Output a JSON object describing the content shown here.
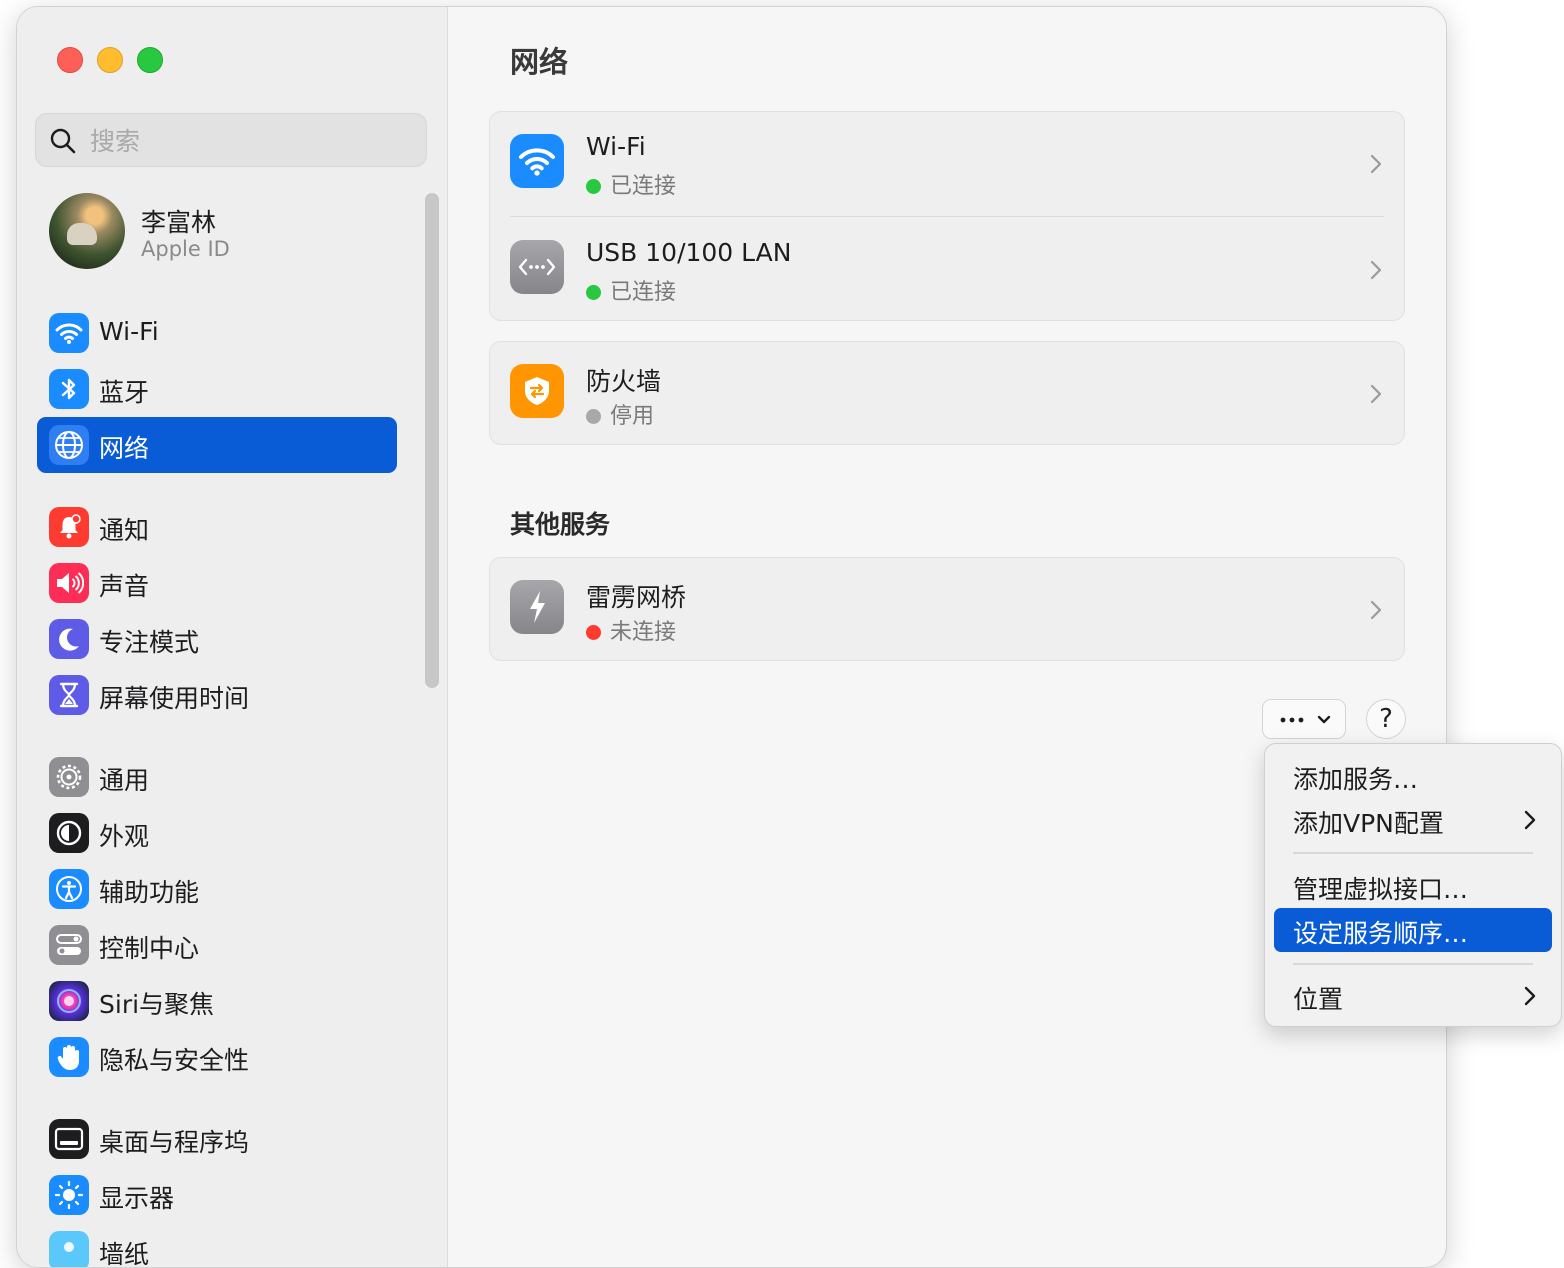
{
  "sidebar": {
    "search_placeholder": "搜索",
    "account": {
      "name": "李富林",
      "subtitle": "Apple ID"
    },
    "items": [
      {
        "label": "Wi-Fi",
        "icon": "wifi-icon",
        "color": "#1a8cff",
        "selected": false
      },
      {
        "label": "蓝牙",
        "icon": "bluetooth-icon",
        "color": "#1a8cff",
        "selected": false
      },
      {
        "label": "网络",
        "icon": "globe-icon",
        "color": "#1a8cff",
        "selected": true
      },
      {
        "label": "通知",
        "icon": "bell-icon",
        "color": "#fe3b30",
        "selected": false
      },
      {
        "label": "声音",
        "icon": "speaker-icon",
        "color": "#fe2d55",
        "selected": false
      },
      {
        "label": "专注模式",
        "icon": "moon-icon",
        "color": "#5e5ce6",
        "selected": false
      },
      {
        "label": "屏幕使用时间",
        "icon": "hourglass-icon",
        "color": "#5e5ce6",
        "selected": false
      },
      {
        "label": "通用",
        "icon": "gear-icon",
        "color": "#8e8e93",
        "selected": false
      },
      {
        "label": "外观",
        "icon": "appearance-icon",
        "color": "#1d1d1f",
        "selected": false
      },
      {
        "label": "辅助功能",
        "icon": "accessibility-icon",
        "color": "#1a8cff",
        "selected": false
      },
      {
        "label": "控制中心",
        "icon": "switches-icon",
        "color": "#8e8e93",
        "selected": false
      },
      {
        "label": "Siri与聚焦",
        "icon": "siri-icon",
        "color": "#6a3fd8",
        "selected": false
      },
      {
        "label": "隐私与安全性",
        "icon": "hand-icon",
        "color": "#1a8cff",
        "selected": false
      },
      {
        "label": "桌面与程序坞",
        "icon": "dock-icon",
        "color": "#1d1d1f",
        "selected": false
      },
      {
        "label": "显示器",
        "icon": "sun-icon",
        "color": "#1a8cff",
        "selected": false
      },
      {
        "label": "墙纸",
        "icon": "wallpaper-icon",
        "color": "#5ac8fa",
        "selected": false
      }
    ]
  },
  "main": {
    "title": "网络",
    "services": [
      {
        "name": "Wi-Fi",
        "status": "已连接",
        "status_color": "#28c840",
        "icon": "wifi-icon",
        "icon_color": "#1a8cff"
      },
      {
        "name": "USB 10/100 LAN",
        "status": "已连接",
        "status_color": "#28c840",
        "icon": "ethernet-icon",
        "icon_color": "#8e8e93"
      }
    ],
    "firewall": {
      "name": "防火墙",
      "status": "停用",
      "status_color": "#a8a8a8",
      "icon": "firewall-icon",
      "icon_color": "#ff9500"
    },
    "other_title": "其他服务",
    "other_services": [
      {
        "name": "雷雳网桥",
        "status": "未连接",
        "status_color": "#ff3b30",
        "icon": "thunderbolt-icon",
        "icon_color": "#8e8e93"
      }
    ],
    "more_button": "more-actions-icon",
    "help_label": "?"
  },
  "menu": {
    "items": [
      {
        "label": "添加服务…",
        "submenu": false,
        "highlighted": false
      },
      {
        "label": "添加VPN配置",
        "submenu": true,
        "highlighted": false
      },
      {
        "label": "管理虚拟接口…",
        "submenu": false,
        "highlighted": false
      },
      {
        "label": "设定服务顺序…",
        "submenu": false,
        "highlighted": true
      },
      {
        "label": "位置",
        "submenu": true,
        "highlighted": false
      }
    ]
  }
}
